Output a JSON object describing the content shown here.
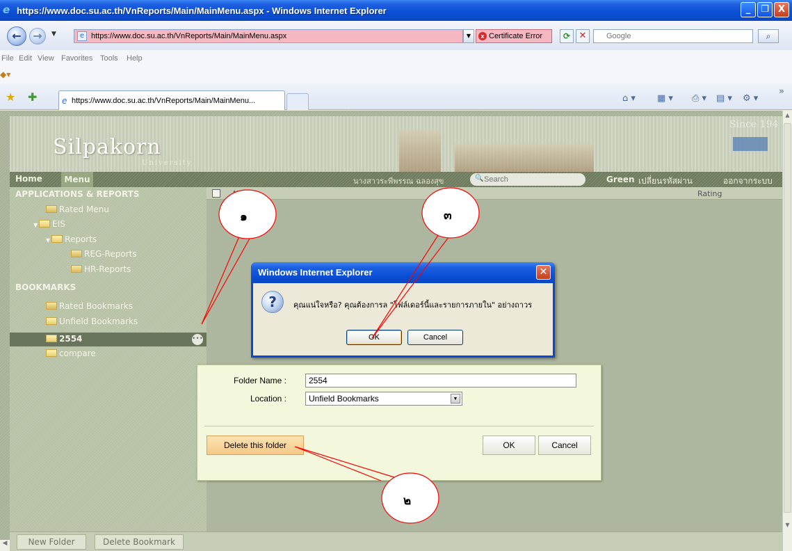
{
  "window": {
    "title": "https://www.doc.su.ac.th/VnReports/Main/MainMenu.aspx - Windows Internet Explorer",
    "minimize": "_",
    "restore": "❐",
    "close": "X"
  },
  "address_bar": {
    "url": "https://www.doc.su.ac.th/VnReports/Main/MainMenu.aspx",
    "cert_error": "Certificate Error",
    "search_placeholder": "Google"
  },
  "menu": {
    "items": [
      "File",
      "Edit",
      "View",
      "Favorites",
      "Tools",
      "Help"
    ]
  },
  "tabs": {
    "active_label": "https://www.doc.su.ac.th/VnReports/Main/MainMenu..."
  },
  "site": {
    "logo_text": "Silpakorn",
    "logo_sub": "University",
    "since": "Since 194",
    "nav_home": "Home",
    "nav_menu": "Menu",
    "user_name": "นางสาวระพีพรรณ ฉลองสุข",
    "search_placeholder": "Search",
    "theme": "Green",
    "change_password": "เปลี่ยนรหัสผ่าน",
    "logout": "ออกจากระบบ"
  },
  "sidebar": {
    "apps_header": "APPLICATIONS & REPORTS",
    "rated_menu": "Rated Menu",
    "eis": "EIS",
    "reports": "Reports",
    "reg_reports": "REG-Reports",
    "hr_reports": "HR-Reports",
    "bookmarks_header": "BOOKMARKS",
    "rated_bookmarks": "Rated Bookmarks",
    "unfield_bookmarks": "Unfield Bookmarks",
    "folder_2554": "2554",
    "folder_compare": "compare"
  },
  "content": {
    "col_name": "Name",
    "col_rating": "Rating"
  },
  "bottom": {
    "new_folder": "New Folder",
    "delete_bookmark": "Delete Bookmark"
  },
  "edit_panel": {
    "folder_name_label": "Folder Name :",
    "folder_name_value": "2554",
    "location_label": "Location :",
    "location_value": "Unfield Bookmarks",
    "delete_button": "Delete this folder",
    "ok_button": "OK",
    "cancel_button": "Cancel"
  },
  "dialog": {
    "title": "Windows Internet Explorer",
    "message": "คุณแน่ใจหรือ? คุณต้องการล  \"โฟล์เดอร์นี้และรายการภายใน\" อย่างถาวร",
    "ok": "OK",
    "cancel": "Cancel"
  },
  "annotations": {
    "c1": "๑",
    "c2": "๒",
    "c3": "๓",
    "stroke_color": "#ff0000",
    "bubble_border": "#ff0000",
    "bubble_fill": "#ffffff"
  }
}
